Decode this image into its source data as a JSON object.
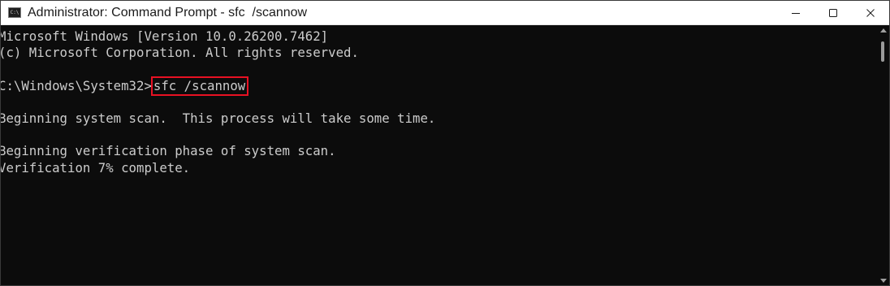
{
  "window": {
    "title": "Administrator: Command Prompt - sfc  /scannow",
    "app_icon_text": "C:\\"
  },
  "controls": {
    "minimize_icon": "minimize-icon",
    "maximize_icon": "maximize-icon",
    "close_icon": "close-icon"
  },
  "console": {
    "lines": [
      "Microsoft Windows [Version 10.0.26200.7462]",
      "(c) Microsoft Corporation. All rights reserved.",
      "",
      "",
      "",
      "Beginning system scan.  This process will take some time.",
      "",
      "Beginning verification phase of system scan.",
      "Verification 7% complete."
    ],
    "prompt": "C:\\Windows\\System32>",
    "command": "sfc /scannow"
  },
  "colors": {
    "console_bg": "#0c0c0c",
    "console_text": "#cccccc",
    "highlight_box": "#e81123"
  }
}
